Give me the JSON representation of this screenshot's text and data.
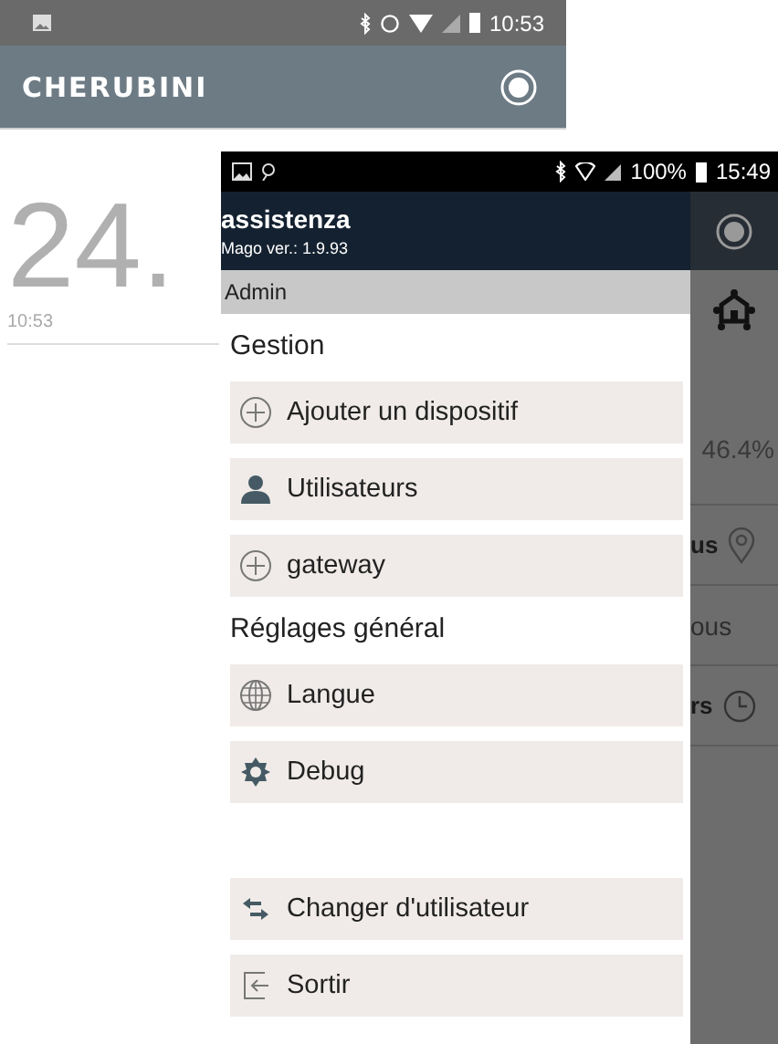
{
  "background_screen": {
    "status_bar": {
      "time": "10:53"
    },
    "app_bar": {
      "logo": "CHERUBINI"
    },
    "temperature": "24.",
    "reading_time": "10:53"
  },
  "foreground_screen": {
    "status_bar": {
      "battery": "100%",
      "time": "15:49"
    },
    "drawer": {
      "user": "assistenza",
      "version": "Mago ver.: 1.9.93",
      "role": "Admin",
      "sections": [
        {
          "title": "Gestion",
          "items": [
            {
              "label": "Ajouter un dispositif",
              "kind": "add"
            },
            {
              "label": "Utilisateurs",
              "kind": "user"
            },
            {
              "label": "gateway",
              "kind": "add"
            }
          ]
        },
        {
          "title": "Réglages général",
          "items": [
            {
              "label": "Langue",
              "kind": "globe"
            },
            {
              "label": "Debug",
              "kind": "gear"
            }
          ]
        },
        {
          "items": [
            {
              "label": "Changer d'utilisateur",
              "kind": "swap"
            },
            {
              "label": "Sortir",
              "kind": "exit"
            }
          ]
        }
      ]
    },
    "behind": {
      "humidity": "46.4%",
      "rows": [
        {
          "text": "us",
          "kind": "pin",
          "dim": false
        },
        {
          "text": "ous",
          "dim": true
        },
        {
          "text": "rs",
          "kind": "clock",
          "dim": false
        }
      ]
    }
  }
}
